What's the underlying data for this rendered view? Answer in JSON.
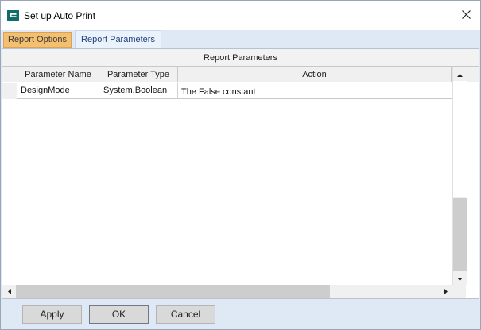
{
  "window": {
    "title": "Set up Auto Print",
    "app_icon": "entity-logo-icon",
    "close_icon": "close-icon"
  },
  "tabs": [
    {
      "label": "Report Options",
      "state": "highlighted"
    },
    {
      "label": "Report Parameters",
      "state": "selected"
    }
  ],
  "grid": {
    "caption": "Report Parameters",
    "columns": [
      "Parameter Name",
      "Parameter Type",
      "Action"
    ],
    "rows": [
      {
        "name": "DesignMode",
        "type": "System.Boolean",
        "action": "The False constant"
      }
    ]
  },
  "scrollbars": {
    "up_icon": "triangle-up-icon",
    "down_icon": "triangle-down-icon",
    "left_icon": "triangle-left-icon",
    "right_icon": "triangle-right-icon"
  },
  "buttons": {
    "apply": "Apply",
    "ok": "OK",
    "cancel": "Cancel"
  },
  "colors": {
    "tab_highlight": "#f5bf70",
    "app_icon": "#106b6a",
    "window_background": "#dfe9f5"
  }
}
